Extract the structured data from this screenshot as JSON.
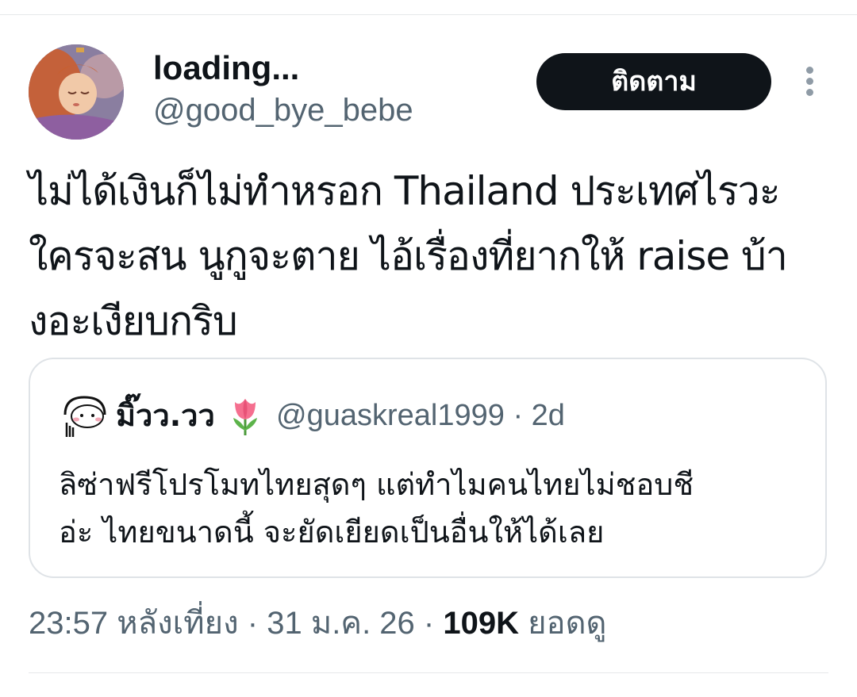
{
  "author": {
    "display_name": "loading...",
    "handle": "@good_bye_bebe",
    "avatar_caption": "me up when I'm rich"
  },
  "actions": {
    "follow_label": "ติดตาม",
    "more_icon": "more-vertical-icon"
  },
  "tweet": {
    "text_lines": [
      "ไม่ได้เงินก็ไม่ทำหรอก Thailand ประเทศไรวะ",
      "ใครจะสน นูกูจะตาย ไอ้เรื่องที่ยากให้ raise บ้า",
      "งอะเงียบกริบ"
    ]
  },
  "quote": {
    "display_name": "มิ๊วว.วว",
    "emoji_icon": "tulip-icon",
    "handle": "@guaskreal1999",
    "separator": "·",
    "age": "2d",
    "text_lines": [
      "ลิซ่าฟรีโปรโมทไทยสุดๆ แต่ทำไมคนไทยไม่ชอบชี",
      "อ่ะ  ไทยขนาดนี้ จะยัดเยียดเป็นอื่นให้ได้เลย"
    ]
  },
  "meta": {
    "time": "23:57 หลังเที่ยง",
    "separator": "·",
    "date": "31 ม.ค. 26",
    "views_count": "109K",
    "views_label": "ยอดดู"
  },
  "colors": {
    "text_primary": "#0f1419",
    "text_secondary": "#536471",
    "button_bg": "#0f1419",
    "border": "#dfe3e7"
  }
}
